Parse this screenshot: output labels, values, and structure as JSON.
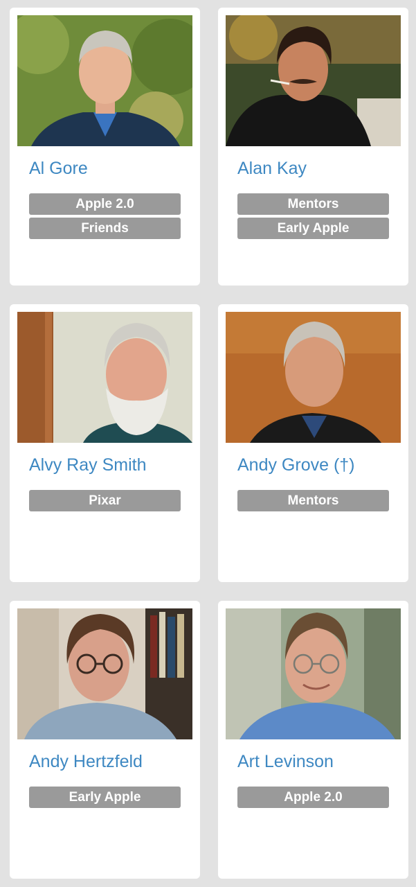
{
  "people": [
    {
      "name": "Al Gore",
      "tags": [
        "Apple 2.0",
        "Friends"
      ]
    },
    {
      "name": "Alan Kay",
      "tags": [
        "Mentors",
        "Early Apple"
      ]
    },
    {
      "name": "Alvy Ray Smith",
      "tags": [
        "Pixar"
      ]
    },
    {
      "name": "Andy Grove (†)",
      "tags": [
        "Mentors"
      ]
    },
    {
      "name": "Andy Hertzfeld",
      "tags": [
        "Early Apple"
      ]
    },
    {
      "name": "Art Levinson",
      "tags": [
        "Apple 2.0"
      ]
    }
  ],
  "colors": {
    "background": "#e2e2e2",
    "card": "#ffffff",
    "name_link": "#3e88c2",
    "tag_bg": "#9a9a9a",
    "tag_text": "#ffffff"
  }
}
